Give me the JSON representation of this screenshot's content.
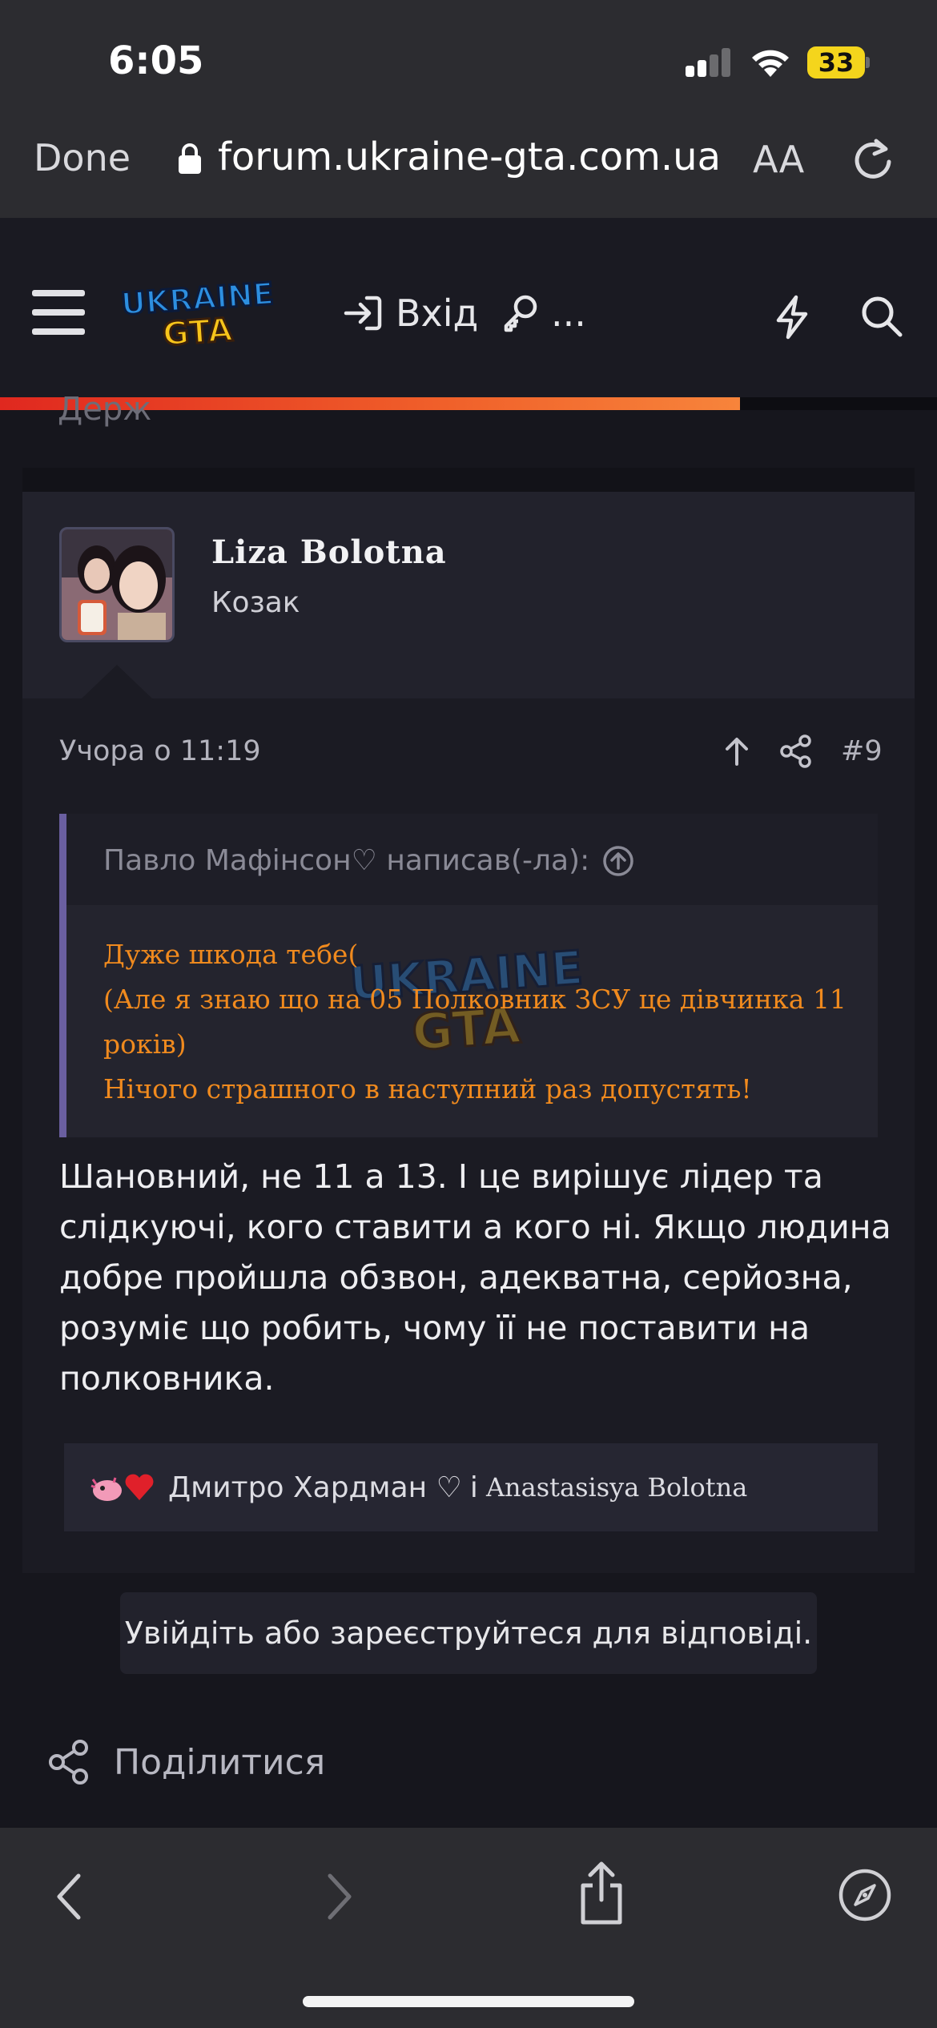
{
  "status_bar": {
    "time": "6:05",
    "battery": "33"
  },
  "browser": {
    "done_label": "Done",
    "url": "forum.ukraine-gta.com.ua",
    "text_size_label": "AA"
  },
  "forum_header": {
    "logo_alt": "UKRAINE GTA",
    "login_label": "Вхід",
    "register_label": "...",
    "scroll_progress_percent": 79
  },
  "peek_text": "Держ",
  "post": {
    "username": "Liza Bolotna",
    "user_title": "Козак",
    "date": "Учора о 11:19",
    "number": "#9",
    "quote": {
      "author": "Павло Мафінсон♡ написав(-ла):",
      "lines": [
        "Дуже шкода тебе(",
        "(Але я знаю що на 05 Полковник ЗСУ це дівчинка 11 років)",
        "Нічого страшного в наступний раз допустять!"
      ]
    },
    "body": "Шановний, не 11 а 13. І це вирішує лідер та слідкуючі, кого ставити а кого ні. Якщо людина добре пройшла обзвон, адекватна, серйозна, розуміє що робить, чому її не поставити на полковника.",
    "reactions": {
      "name1": "Дмитро Хардман ♡",
      "conjunction": "і",
      "name2": "Anastasisya Bolotna"
    }
  },
  "login_prompt": "Увійдіть або зареєструйтеся для відповіді.",
  "share_label": "Поділитися",
  "colors": {
    "accent_orange": "#f08a1e",
    "quote_border": "#6a5fa0",
    "progress_red": "#e0281f"
  }
}
